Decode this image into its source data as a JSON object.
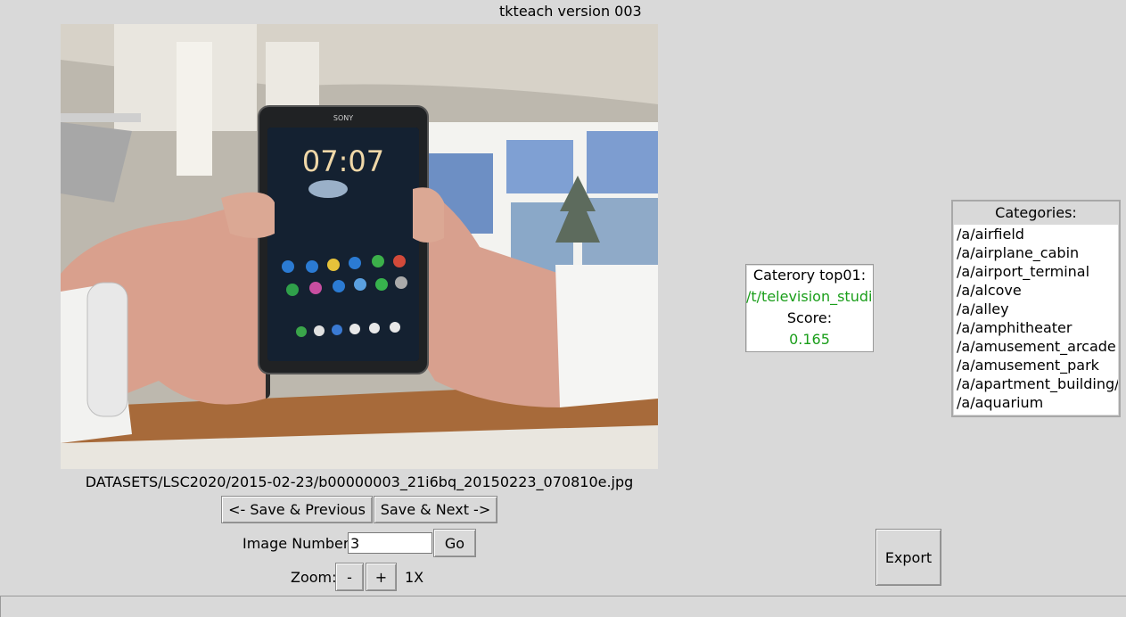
{
  "window": {
    "title": "tkteach version 003"
  },
  "image": {
    "filepath": "DATASETS/LSC2020/2015-02-23/b00000003_21i6bq_20150223_070810e.jpg",
    "phone_brand": "SONY",
    "phone_clock": "07:07"
  },
  "navigation": {
    "prev_label": "<- Save & Previous",
    "next_label": "Save & Next ->",
    "image_number_label": "Image Number:",
    "image_number_value": "3",
    "go_label": "Go"
  },
  "zoom": {
    "label": "Zoom:",
    "minus_label": "-",
    "plus_label": "+",
    "value": "1X"
  },
  "prediction": {
    "category_label": "Caterory top01:",
    "category_value": "/t/television_studio",
    "score_label": "Score:",
    "score_value": "0.165",
    "value_color": "#1a9e1a"
  },
  "categories": {
    "title": "Categories:",
    "items": [
      "/a/airfield",
      "/a/airplane_cabin",
      "/a/airport_terminal",
      "/a/alcove",
      "/a/alley",
      "/a/amphitheater",
      "/a/amusement_arcade",
      "/a/amusement_park",
      "/a/apartment_building/outdoor",
      "/a/aquarium"
    ]
  },
  "export": {
    "label": "Export"
  }
}
